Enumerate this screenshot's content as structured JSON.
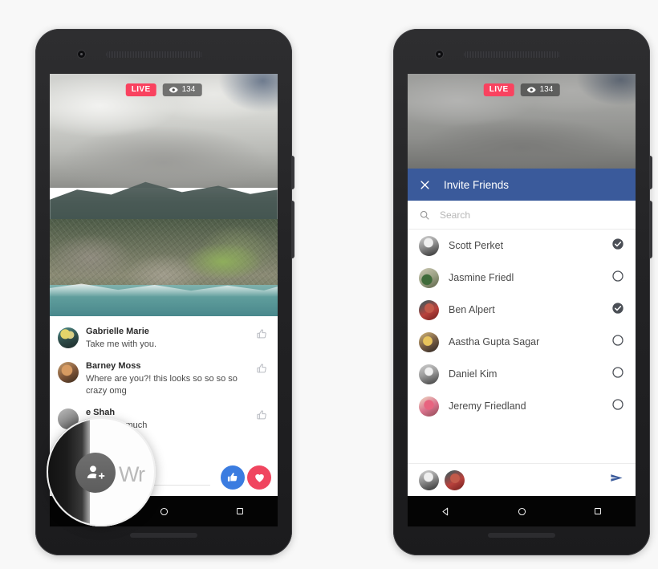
{
  "scene": {
    "background_color": "#f8f8f8",
    "phone_count": 2
  },
  "left_phone": {
    "name": "facebook-live-viewer-screen",
    "video_overlay": {
      "live_label": "LIVE",
      "live_color": "#f9425f",
      "viewer_count": "134",
      "eye_icon": "eye-icon"
    },
    "comments": [
      {
        "author": "Gabrielle Marie",
        "text": "Take me with you.",
        "like_icon": "thumbs-up-outline-icon"
      },
      {
        "author": "Barney Moss",
        "text": "Where are you?! this looks so so so so crazy omg",
        "like_icon": "thumbs-up-outline-icon"
      },
      {
        "author": "e Shah",
        "text": "ve this so much",
        "like_icon": "thumbs-up-outline-icon"
      }
    ],
    "composer": {
      "placeholder": "Write a comment...",
      "visible_placeholder": "mment...",
      "like_button_icon": "thumbs-up-filled-icon",
      "like_button_color": "#3b7ce0",
      "heart_button_icon": "heart-filled-icon",
      "heart_button_color": "#f0455f"
    },
    "magnifier": {
      "button_icon": "add-person-icon",
      "magnified_text": "Wr"
    },
    "navbar": {
      "back_icon": "triangle-back-icon",
      "home_icon": "circle-home-icon",
      "recents_icon": "square-recents-icon"
    }
  },
  "right_phone": {
    "name": "invite-friends-screen",
    "video_overlay": {
      "live_label": "LIVE",
      "live_color": "#f9425f",
      "viewer_count": "134",
      "eye_icon": "eye-icon"
    },
    "sheet": {
      "close_icon": "close-x-icon",
      "title": "Invite Friends",
      "header_color": "#3a5a9b",
      "search": {
        "icon": "search-icon",
        "placeholder": "Search"
      },
      "friends": [
        {
          "name": "Scott Perket",
          "selected": true,
          "avatar_class": "av1"
        },
        {
          "name": "Jasmine Friedl",
          "selected": false,
          "avatar_class": "av2"
        },
        {
          "name": "Ben Alpert",
          "selected": true,
          "avatar_class": "av3"
        },
        {
          "name": "Aastha Gupta Sagar",
          "selected": false,
          "avatar_class": "av4"
        },
        {
          "name": "Daniel Kim",
          "selected": false,
          "avatar_class": "av5"
        },
        {
          "name": "Jeremy Friedland",
          "selected": false,
          "avatar_class": "av6"
        }
      ],
      "send_bar": {
        "selected_avatars": [
          "av1",
          "av3"
        ],
        "send_icon": "send-arrow-icon",
        "send_color": "#3a5a9b"
      }
    },
    "navbar": {
      "back_icon": "triangle-back-icon",
      "home_icon": "circle-home-icon",
      "recents_icon": "square-recents-icon"
    }
  }
}
